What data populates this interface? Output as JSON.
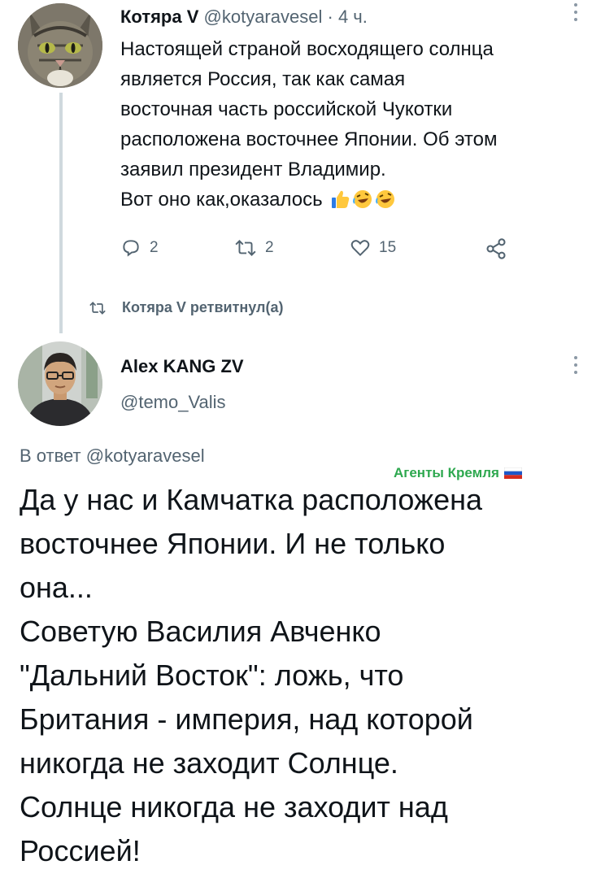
{
  "tweet1": {
    "author_name": "Котяра V",
    "author_handle": "@kotyaravesel",
    "separator": "·",
    "time": "4 ч.",
    "body_lines": [
      "Настоящей страной восходящего солнца",
      "является Россия, так как самая",
      "восточная часть российской Чукотки",
      "расположена восточнее Японии. Об этом",
      "заявил президент Владимир.",
      "Вот оно как,оказалось"
    ],
    "emojis": [
      "thumbs-up",
      "rolling-on-floor-laughing",
      "rolling-on-floor-laughing"
    ],
    "actions": {
      "reply_count": "2",
      "retweet_count": "2",
      "like_count": "15"
    }
  },
  "retweet_notice": "Котяра V ретвитнул(а)",
  "tweet2": {
    "author_name": "Alex KANG ZV",
    "author_handle": "@temo_Valis",
    "reply_prefix": "В ответ",
    "reply_to": "@kotyaravesel",
    "watermark": "Агенты Кремля",
    "body_lines": [
      "Да у нас и Камчатка расположена",
      "восточнее Японии. И не только",
      "она...",
      "Советую Василия Авченко",
      "\"Дальний Восток\": ложь, что",
      "Британия - империя, над которой",
      "никогда не заходит Солнце.",
      "Солнце никогда не заходит над",
      "Россией!"
    ]
  },
  "colors": {
    "text": "#0f1419",
    "secondary": "#536471",
    "thread_line": "#cfd9de",
    "watermark": "#2ea84f"
  },
  "icons": [
    "reply-icon",
    "retweet-icon",
    "like-icon",
    "share-icon",
    "more-icon",
    "retweet-small-icon",
    "russia-flag-icon"
  ]
}
